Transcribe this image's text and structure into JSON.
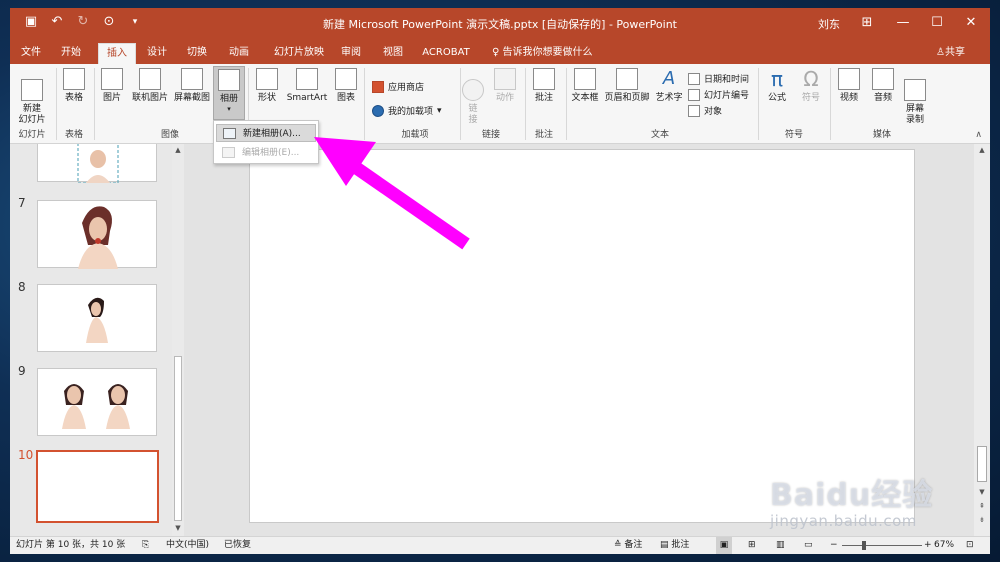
{
  "titlebar": {
    "doc_title": "新建 Microsoft PowerPoint 演示文稿.pptx [自动保存的]  -  PowerPoint",
    "user": "刘东",
    "qat_icons": [
      "save-icon",
      "undo-icon",
      "redo-icon",
      "present-icon",
      "customize-icon"
    ],
    "window_buttons": [
      "ribbon-display-icon",
      "minimize-icon",
      "maximize-icon",
      "close-icon"
    ]
  },
  "tabs": [
    "文件",
    "开始",
    "插入",
    "设计",
    "切换",
    "动画",
    "幻灯片放映",
    "审阅",
    "视图",
    "ACROBAT"
  ],
  "active_tab": "插入",
  "tell_me": "告诉我你想要做什么",
  "share": "共享",
  "ribbon": {
    "new_slide": "新建\n幻灯片",
    "table": "表格",
    "picture": "图片",
    "online_picture": "联机图片",
    "screenshot": "屏幕截图",
    "album": "相册",
    "shapes": "形状",
    "smartart": "SmartArt",
    "chart": "图表",
    "store": "应用商店",
    "my_addins": "我的加载项",
    "link": "链\n接",
    "action": "动作",
    "comment": "批注",
    "textbox": "文本框",
    "header_footer": "页眉和页脚",
    "wordart": "艺术字",
    "datetime": "日期和时间",
    "slide_number": "幻灯片编号",
    "object": "对象",
    "equation": "公式",
    "symbol": "符号",
    "video": "视频",
    "audio": "音频",
    "screen_recording": "屏幕\n录制",
    "groups": {
      "slides": "幻灯片",
      "tables": "表格",
      "images": "图像",
      "addins": "加载项",
      "links": "链接",
      "comments": "批注",
      "text": "文本",
      "symbols": "符号",
      "media": "媒体"
    }
  },
  "album_menu": {
    "new_album": "新建相册(A)...",
    "edit_album": "编辑相册(E)..."
  },
  "thumbnails": [
    {
      "num": "",
      "has_image": "partial"
    },
    {
      "num": "7",
      "has_image": "woman-portrait"
    },
    {
      "num": "8",
      "has_image": "woman-small"
    },
    {
      "num": "9",
      "has_image": "two-women"
    },
    {
      "num": "10",
      "has_image": "none",
      "selected": true
    }
  ],
  "status": {
    "slide_info": "幻灯片 第 10 张，共 10 张",
    "language": "中文(中国)",
    "recovered": "已恢复",
    "notes": "备注",
    "comments": "批注",
    "zoom": "67%"
  },
  "watermark": {
    "brand": "Baidu经验",
    "url": "jingyan.baidu.com"
  },
  "colors": {
    "accent": "#b7472a",
    "arrow": "#ff00ff",
    "selected_slide": "#d35230"
  }
}
